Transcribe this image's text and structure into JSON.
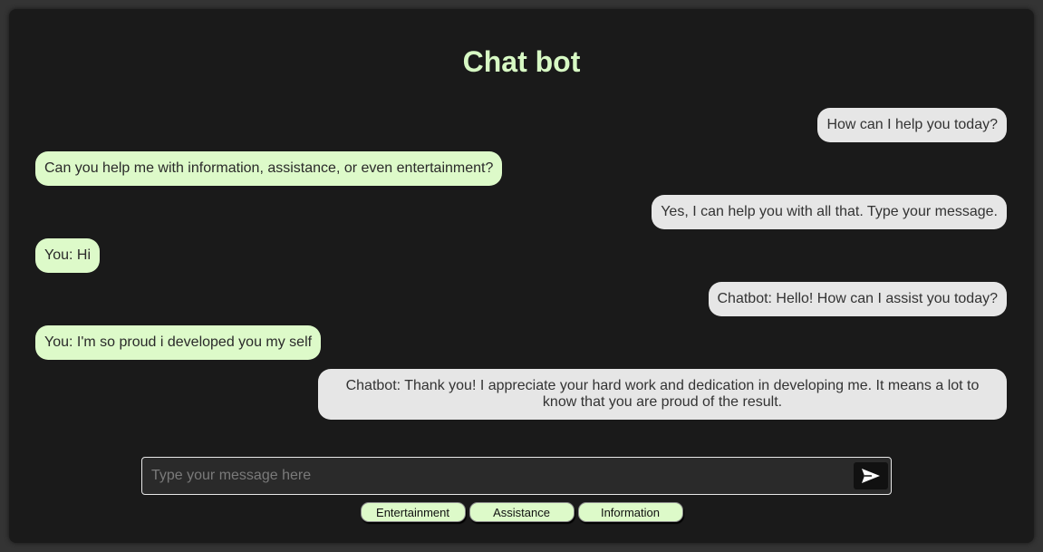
{
  "header": {
    "title": "Chat bot"
  },
  "messages": [
    {
      "role": "bot",
      "text": "How can I help you today?"
    },
    {
      "role": "user",
      "text": "Can you help me with information, assistance, or even entertainment?"
    },
    {
      "role": "bot",
      "text": "Yes, I can help you with all that. Type your message."
    },
    {
      "role": "user",
      "text": "You: Hi"
    },
    {
      "role": "bot",
      "text": "Chatbot: Hello! How can I assist you today?"
    },
    {
      "role": "user",
      "text": "You: I'm so proud i developed you my self"
    },
    {
      "role": "bot",
      "text": "Chatbot: Thank you! I appreciate your hard work and dedication in developing me. It means a lot to know that you are proud of the result."
    }
  ],
  "input": {
    "placeholder": "Type your message here",
    "value": ""
  },
  "send": {
    "icon": "send-icon"
  },
  "quick_replies": [
    "Entertainment",
    "Assistance",
    "Information"
  ],
  "colors": {
    "background": "#1a1a1a",
    "accent": "#ddfac9",
    "bot_bubble": "#e6e6e6"
  }
}
